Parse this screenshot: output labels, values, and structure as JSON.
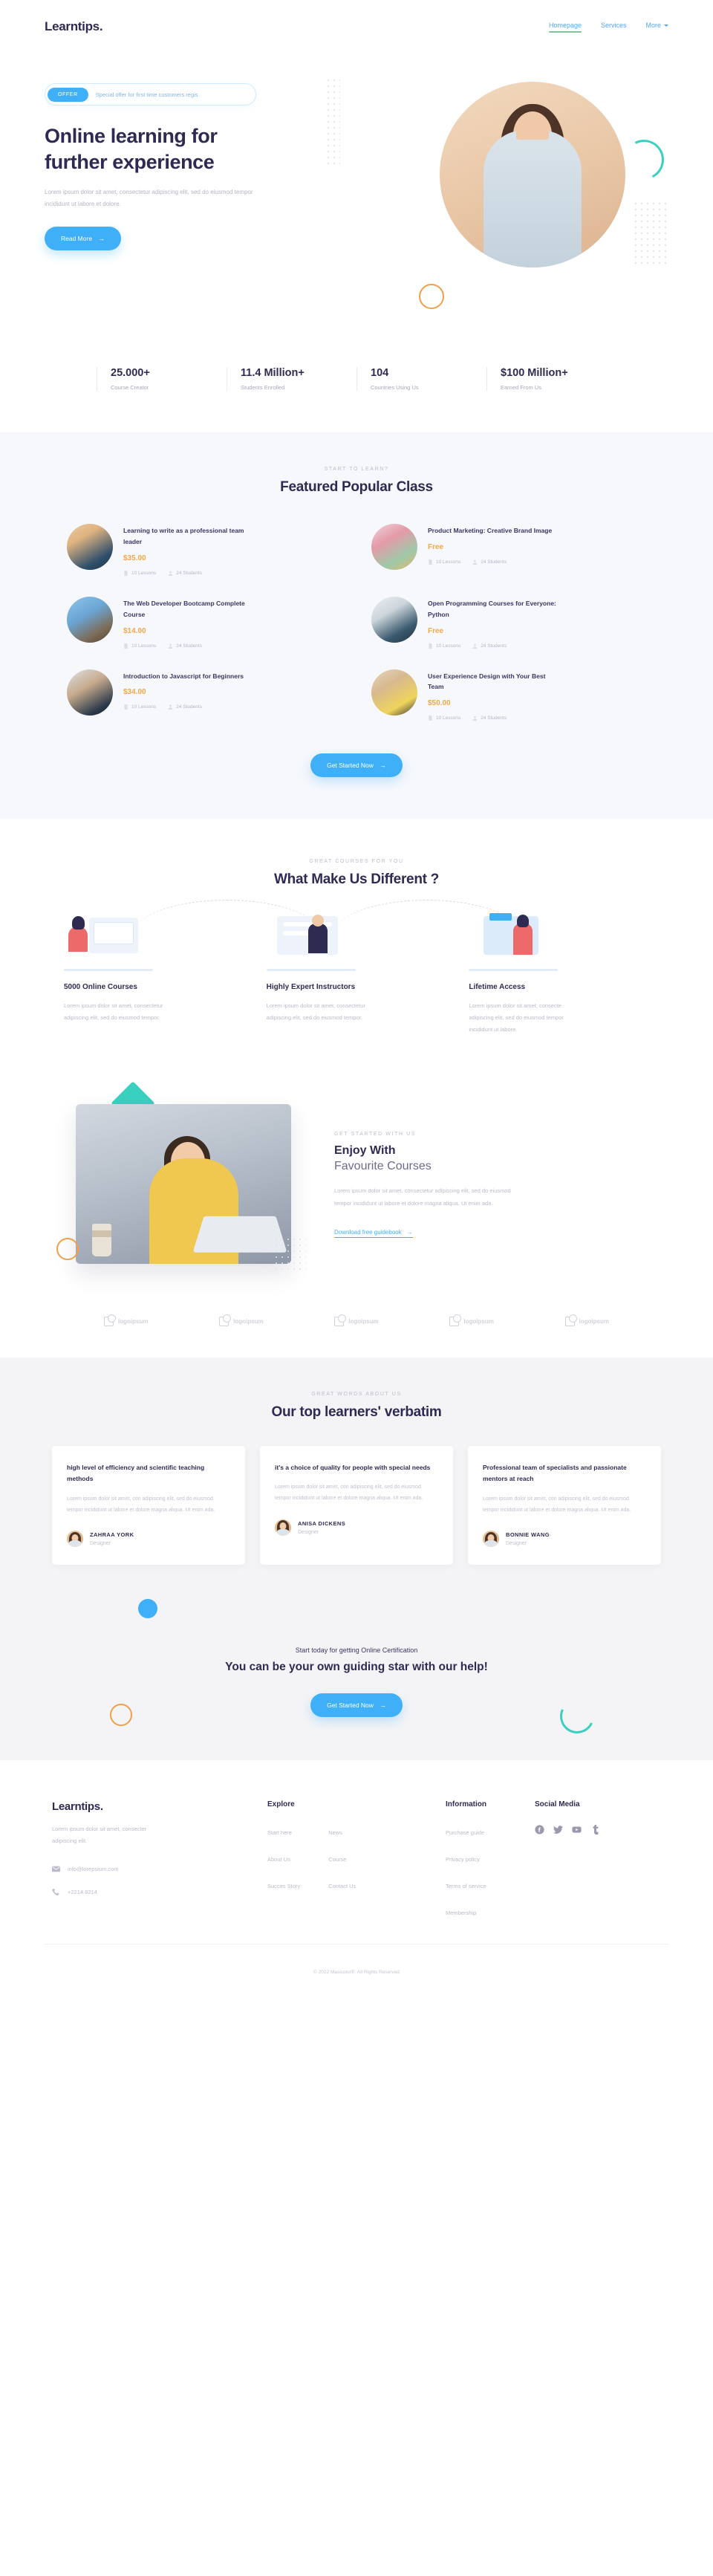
{
  "brand": {
    "name": "Learntips."
  },
  "nav": {
    "items": [
      {
        "label": "Homepage",
        "active": true
      },
      {
        "label": "Services",
        "active": false
      },
      {
        "label": "More",
        "active": false,
        "caret": true
      }
    ]
  },
  "hero": {
    "offer_badge": "OFFER",
    "offer_text": "Special offer for first time customers regis",
    "title_line1": "Online learning for",
    "title_line2": "further experience",
    "lead": "Lorem ipsum dolor sit amet, consectetur adipiscing elit, sed do eiusmod tempor incididunt ut labore et dolore.",
    "cta": "Read More",
    "arrow": "→"
  },
  "stats": [
    {
      "num": "25.000+",
      "label": "Course Creator"
    },
    {
      "num": "11.4 Million+",
      "label": "Students Enrolled"
    },
    {
      "num": "104",
      "label": "Countries Using Us"
    },
    {
      "num": "$100 Million+",
      "label": "Earned From Us"
    }
  ],
  "featured": {
    "eyebrow": "START TO LEARN?",
    "title": "Featured Popular Class",
    "cta": "Get Started Now",
    "arrow": "→",
    "courses": [
      {
        "title": "Learning to write as a professional team leader",
        "price": "$35.00",
        "lessons": "10 Lessons",
        "students": "24 Students"
      },
      {
        "title": "Product Marketing: Creative Brand Image",
        "price": "Free",
        "lessons": "10 Lessons",
        "students": "24 Students"
      },
      {
        "title": "The Web Developer Bootcamp Complete Course",
        "price": "$14.00",
        "lessons": "10 Lessons",
        "students": "24 Students"
      },
      {
        "title": "Open Programming Courses for Everyone: Python",
        "price": "Free",
        "lessons": "10 Lessons",
        "students": "24 Students"
      },
      {
        "title": "Introduction to Javascript for Beginners",
        "price": "$34.00",
        "lessons": "10 Lessons",
        "students": "24 Students"
      },
      {
        "title": "User Experience Design with Your Best Team",
        "price": "$50.00",
        "lessons": "10 Lessons",
        "students": "24 Students"
      }
    ]
  },
  "different": {
    "eyebrow": "GREAT COURSES FOR YOU",
    "title": "What Make Us Different ?",
    "features": [
      {
        "title": "5000 Online Courses",
        "text": "Lorem ipsum dolor sit amet, consectetur adipiscing elit, sed do eiusmod tempor."
      },
      {
        "title": "Highly Expert Instructors",
        "text": "Lorem ipsum dolor sit amet, consectetur adipiscing elit, sed do eiusmod tempor."
      },
      {
        "title": "Lifetime Access",
        "text": "Lorem ipsum dolor sit amet, consecte adipiscing elit, sed do eiusmod tempor incididunt ut labore."
      }
    ]
  },
  "enjoy": {
    "eyebrow": "GET STARTED WITH US",
    "title_bold": "Enjoy With",
    "title_light": "Favourite Courses",
    "text": "Lorem ipsum dolor sit amet, consectetur adipiscing elit, sed do eiusmod tempor incididunt ut labore et dolore magna aliqua. Ut enim ada.",
    "link": "Download free guidebook",
    "arrow": "→"
  },
  "logos": [
    {
      "label": "logoipsum"
    },
    {
      "label": "logoipsum"
    },
    {
      "label": "logoipsum"
    },
    {
      "label": "logoipsum"
    },
    {
      "label": "logoipsum"
    }
  ],
  "testimonials": {
    "eyebrow": "GREAT WORDS ABOUT US",
    "title": "Our top learners' verbatim",
    "items": [
      {
        "quote": "high level of efficiency and scientific teaching methods",
        "text": "Lorem ipsum dolor sit amet, con adipiscing elit, sed do eiusmod tempor incididunt ut labore et dolore magna aliqua. Ut enim ada.",
        "name": "ZAHRAA YORK",
        "role": "Designer"
      },
      {
        "quote": "it's a choice of quality for people with special needs",
        "text": "Lorem ipsum dolor sit amet, con adipiscing elit, sed do eiusmod tempor incididunt ut labore et dolore magna aliqua. Ut enim ada.",
        "name": "ANISA DICKENS",
        "role": "Designer"
      },
      {
        "quote": "Professional team of specialists and passionate mentors at reach",
        "text": "Lorem ipsum dolor sit amet, con adipiscing elit, sed do eiusmod tempor incididunt ut labore et dolore magna aliqua. Ut enim ada.",
        "name": "BONNIE WANG",
        "role": "Designer"
      }
    ]
  },
  "cta": {
    "sub": "Start today for getting Online Certification",
    "title": "You can be your own guiding star with our help!",
    "button": "Get Started Now",
    "arrow": "→"
  },
  "footer": {
    "brand": "Learntips.",
    "about": "Lorem ipsum dolor sit amet, consecter adipiscing elit.",
    "email": "info@lorepsium.com",
    "phone": "+2214 8214",
    "explore": {
      "heading": "Explore",
      "col1": [
        "Start here",
        "About Us",
        "Succes Story"
      ],
      "col2": [
        "News",
        "Course",
        "Contact Us"
      ]
    },
    "information": {
      "heading": "Information",
      "links": [
        "Purchase guide",
        "Privacy policy",
        "Terms of service",
        "Membership"
      ]
    },
    "social": {
      "heading": "Social Media",
      "icons": [
        "facebook-icon",
        "twitter-icon",
        "youtube-icon",
        "tumblr-icon"
      ]
    },
    "copyright": "© 2022 Masicolor®. All Rights Reserved"
  },
  "colors": {
    "accent": "#3fb0f7",
    "dark": "#2e2a52",
    "price": "#f0a84b",
    "green": "#7fc49b",
    "teal": "#3ad0c0",
    "orange": "#f0a04b"
  }
}
